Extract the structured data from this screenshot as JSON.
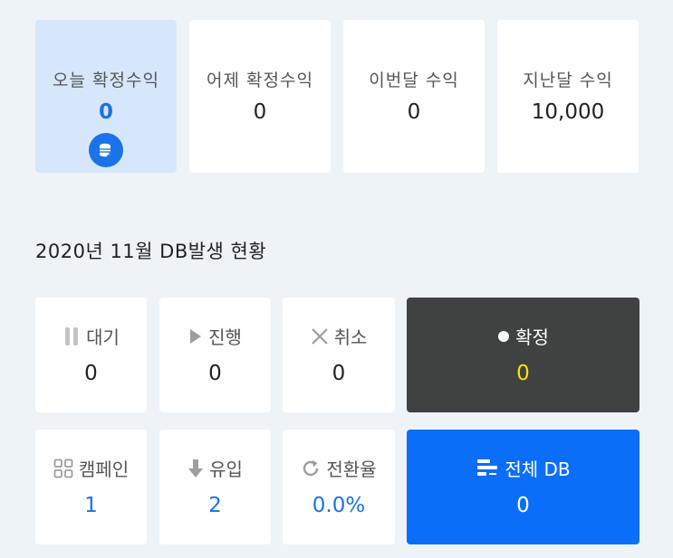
{
  "revenue": [
    {
      "label": "오늘 확정수익",
      "value": "0",
      "active": true
    },
    {
      "label": "어제 확정수익",
      "value": "0"
    },
    {
      "label": "이번달 수익",
      "value": "0"
    },
    {
      "label": "지난달 수익",
      "value": "10,000"
    }
  ],
  "db_icon": "database-icon",
  "section_title": "2020년 11월 DB발생 현황",
  "status": [
    {
      "label": "대기",
      "value": "0",
      "icon": "pause-icon"
    },
    {
      "label": "진행",
      "value": "0",
      "icon": "play-icon"
    },
    {
      "label": "취소",
      "value": "0",
      "icon": "close-icon"
    },
    {
      "label": "확정",
      "value": "0",
      "icon": "dot-icon"
    }
  ],
  "metrics": [
    {
      "label": "캠페인",
      "value": "1",
      "icon": "grid-icon"
    },
    {
      "label": "유입",
      "value": "2",
      "icon": "arrow-down-icon"
    },
    {
      "label": "전환율",
      "value": "0.0%",
      "icon": "refresh-icon"
    },
    {
      "label": "전체 DB",
      "value": "0",
      "icon": "list-bars-icon"
    }
  ],
  "colors": {
    "accent": "#1a73e8",
    "dark_card": "#404242",
    "highlight": "#f5e400",
    "blue_card": "#0b6ef8",
    "active_card": "#d7e7fb",
    "background": "#eef3f8"
  }
}
